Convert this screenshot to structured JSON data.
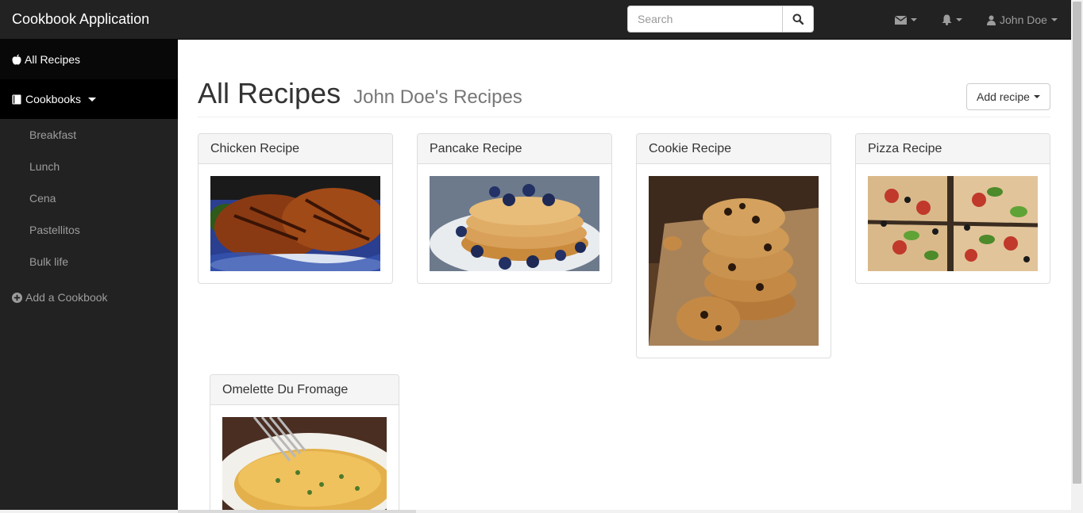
{
  "app": {
    "brand": "Cookbook Application"
  },
  "search": {
    "placeholder": "Search"
  },
  "navbar": {
    "user_name": "John Doe"
  },
  "sidebar": {
    "all_recipes": "All Recipes",
    "cookbooks": "Cookbooks",
    "cookbook_items": [
      "Breakfast",
      "Lunch",
      "Cena",
      "Pastellitos",
      "Bulk life"
    ],
    "add_cookbook": "Add a Cookbook"
  },
  "main": {
    "title": "All Recipes",
    "subtitle": "John Doe's Recipes",
    "add_recipe_label": "Add recipe",
    "recipes": [
      {
        "title": "Chicken Recipe"
      },
      {
        "title": "Pancake Recipe"
      },
      {
        "title": "Cookie Recipe"
      },
      {
        "title": "Pizza Recipe"
      },
      {
        "title": "Omelette Du Fromage"
      }
    ]
  },
  "colors": {
    "navbar_bg": "#222222",
    "sidebar_active_bg": "#080808",
    "panel_heading_bg": "#f5f5f5"
  },
  "icons": [
    "search-icon",
    "envelope-icon",
    "bell-icon",
    "user-icon",
    "apple-icon",
    "book-icon",
    "plus-circle-icon"
  ]
}
